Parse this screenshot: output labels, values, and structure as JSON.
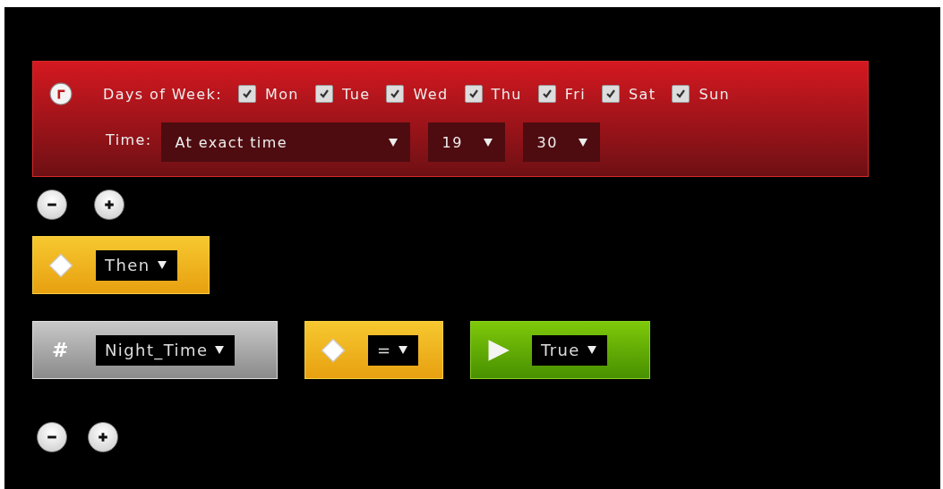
{
  "schedule": {
    "days_label": "Days of Week:",
    "days": [
      {
        "label": "Mon",
        "checked": true
      },
      {
        "label": "Tue",
        "checked": true
      },
      {
        "label": "Wed",
        "checked": true
      },
      {
        "label": "Thu",
        "checked": true
      },
      {
        "label": "Fri",
        "checked": true
      },
      {
        "label": "Sat",
        "checked": true
      },
      {
        "label": "Sun",
        "checked": true
      }
    ],
    "time_label": "Time:",
    "time_mode": "At exact time",
    "hour": "19",
    "minute": "30"
  },
  "then_block": {
    "kind": "operator",
    "value": "Then"
  },
  "condition": [
    {
      "kind": "variable",
      "symbol": "#",
      "value": "Night_Time"
    },
    {
      "kind": "operator",
      "value": "="
    },
    {
      "kind": "value",
      "value": "True"
    }
  ]
}
